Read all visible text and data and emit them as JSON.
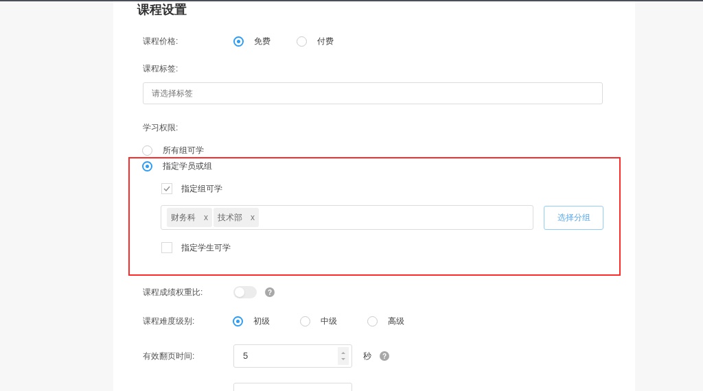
{
  "title": "课程设置",
  "price": {
    "label": "课程价格:",
    "options": [
      {
        "label": "免费",
        "selected": true
      },
      {
        "label": "付费",
        "selected": false
      }
    ]
  },
  "tags": {
    "label": "课程标签:",
    "placeholder": "请选择标签"
  },
  "access": {
    "label": "学习权限:",
    "options": [
      {
        "label": "所有组可学",
        "selected": false
      },
      {
        "label": "指定学员或组",
        "selected": true
      }
    ]
  },
  "group_access": {
    "label": "指定组可学",
    "checked": true,
    "groups": [
      {
        "label": "财务科",
        "remove": "x"
      },
      {
        "label": "技术部",
        "remove": "x"
      }
    ],
    "button": "选择分组"
  },
  "student_access": {
    "label": "指定学生可学",
    "checked": false
  },
  "score_weight": {
    "label": "课程成绩权重比:",
    "on": false,
    "help": "?"
  },
  "difficulty": {
    "label": "课程难度级别:",
    "options": [
      {
        "label": "初级",
        "selected": true
      },
      {
        "label": "中级",
        "selected": false
      },
      {
        "label": "高级",
        "selected": false
      }
    ]
  },
  "page_time": {
    "label": "有效翻页时间:",
    "value": "5",
    "unit": "秒",
    "help": "?"
  }
}
